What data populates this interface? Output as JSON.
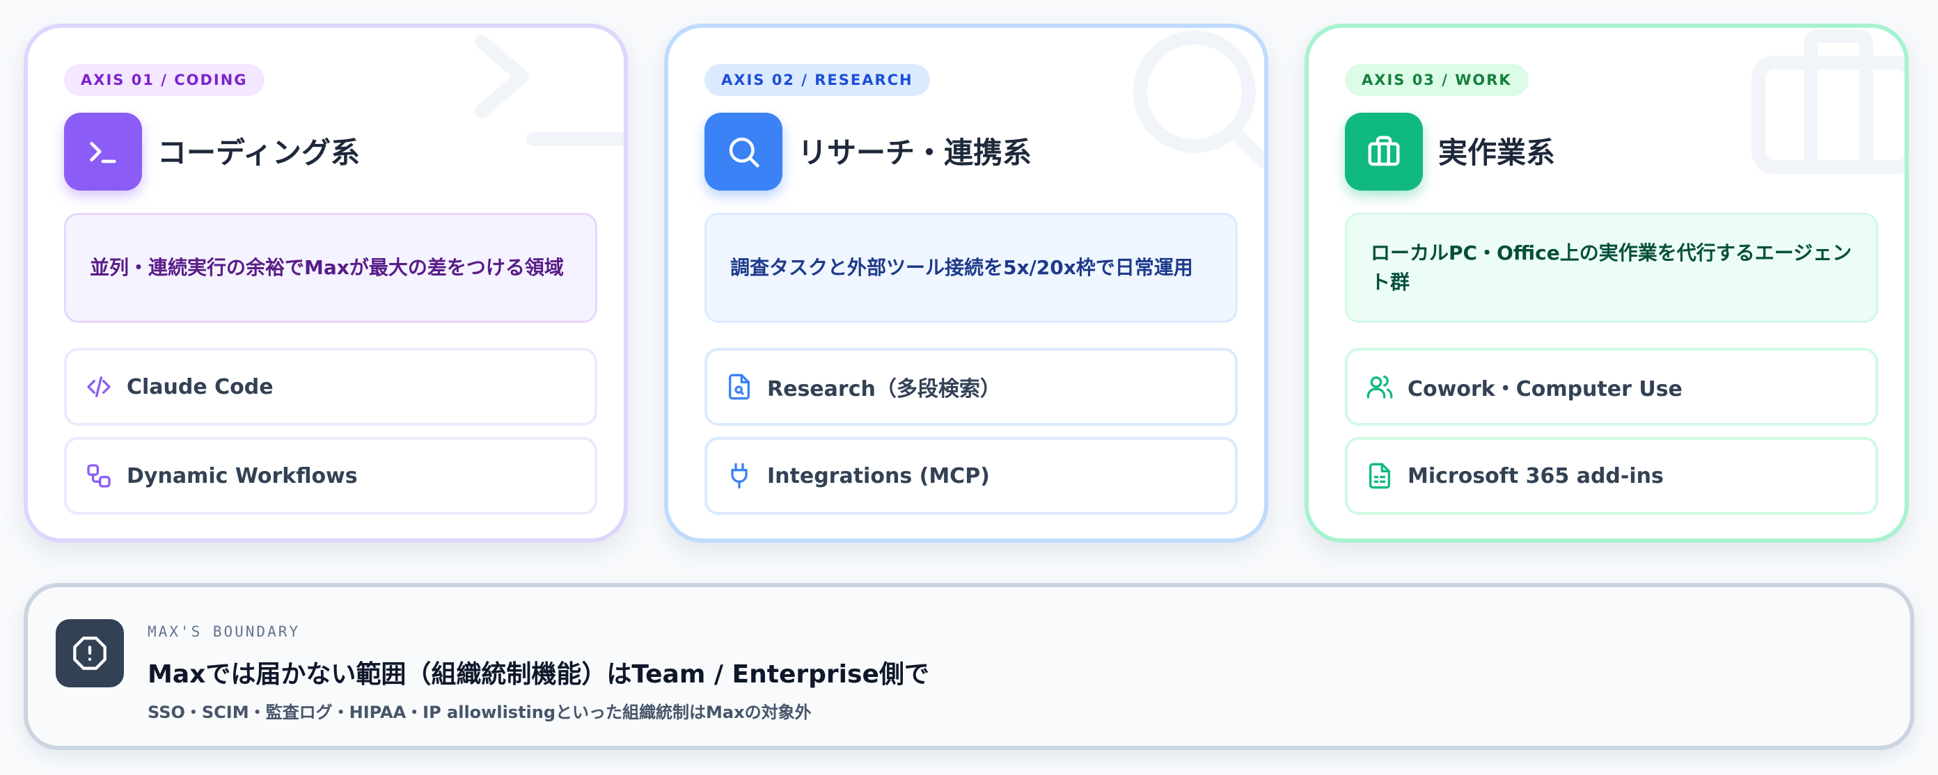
{
  "cards": [
    {
      "badge": "AXIS 01 / CODING",
      "title": "コーディング系",
      "description": "並列・連続実行の余裕でMaxが最大の差をつける領域",
      "items": [
        {
          "label": "Claude Code",
          "icon": "code-icon"
        },
        {
          "label": "Dynamic Workflows",
          "icon": "workflow-icon"
        }
      ],
      "icon": "terminal-icon",
      "accent": "#8b5cf6"
    },
    {
      "badge": "AXIS 02 / RESEARCH",
      "title": "リサーチ・連携系",
      "description": "調査タスクと外部ツール接続を5x/20x枠で日常運用",
      "items": [
        {
          "label": "Research（多段検索）",
          "icon": "file-search-icon"
        },
        {
          "label": "Integrations (MCP)",
          "icon": "plug-icon"
        }
      ],
      "icon": "search-icon",
      "accent": "#3b82f6"
    },
    {
      "badge": "AXIS 03 / WORK",
      "title": "実作業系",
      "description": "ローカルPC・Office上の実作業を代行するエージェント群",
      "items": [
        {
          "label": "Cowork・Computer Use",
          "icon": "users-icon"
        },
        {
          "label": "Microsoft 365 add-ins",
          "icon": "spreadsheet-icon"
        }
      ],
      "icon": "briefcase-icon",
      "accent": "#10b981"
    }
  ],
  "boundary": {
    "kicker": "MAX'S BOUNDARY",
    "title": "Maxでは届かない範囲（組織統制機能）はTeam / Enterprise側で",
    "subtitle": "SSO・SCIM・監査ログ・HIPAA・IP allowlistingといった組織統制はMaxの対象外",
    "icon": "alert-octagon-icon"
  }
}
